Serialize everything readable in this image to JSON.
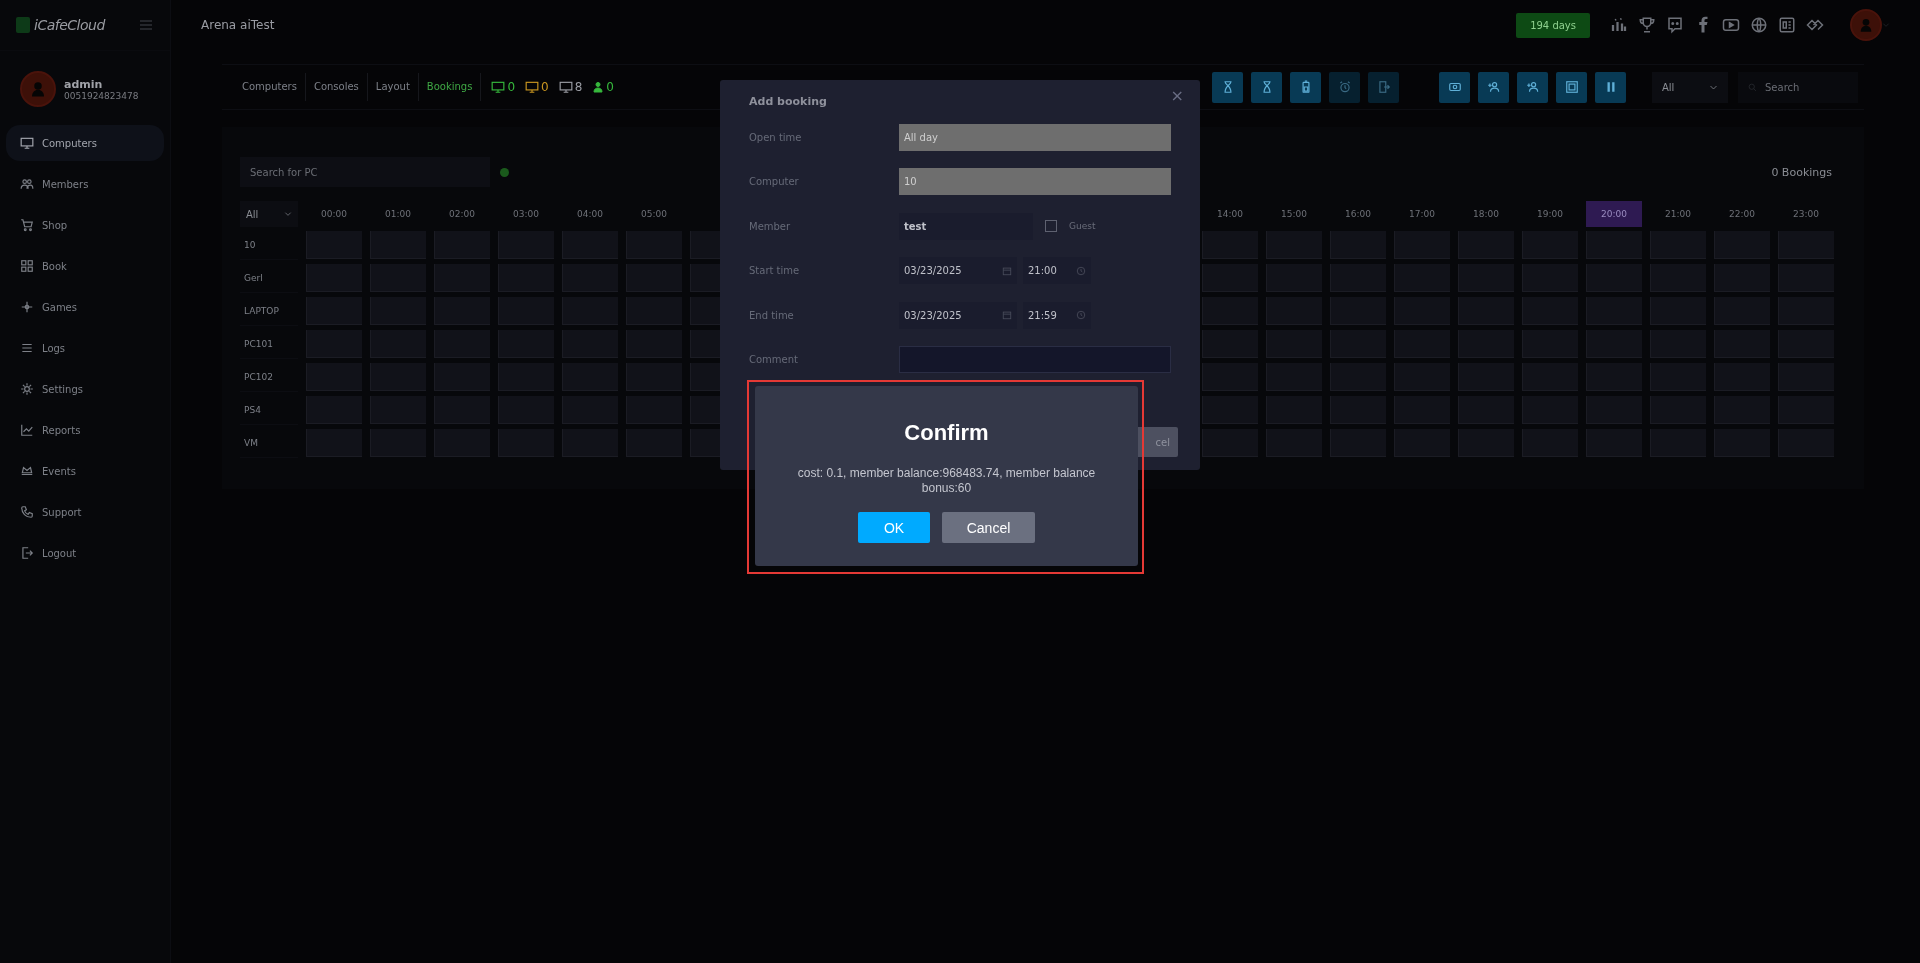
{
  "app": {
    "logo": "iCafeCloud",
    "title": "Arena aiTest"
  },
  "user": {
    "name": "admin",
    "phone": "0051924823478"
  },
  "nav": [
    {
      "label": "Computers",
      "selected": true
    },
    {
      "label": "Members",
      "selected": false
    },
    {
      "label": "Shop",
      "selected": false
    },
    {
      "label": "Book",
      "selected": false
    },
    {
      "label": "Games",
      "selected": false
    },
    {
      "label": "Logs",
      "selected": false
    },
    {
      "label": "Settings",
      "selected": false
    },
    {
      "label": "Reports",
      "selected": false
    },
    {
      "label": "Events",
      "selected": false
    },
    {
      "label": "Support",
      "selected": false
    },
    {
      "label": "Logout",
      "selected": false
    }
  ],
  "license": {
    "days": "194 days"
  },
  "tabs": [
    {
      "label": "Computers",
      "selected": false
    },
    {
      "label": "Consoles",
      "selected": false
    },
    {
      "label": "Layout",
      "selected": false
    },
    {
      "label": "Bookings",
      "selected": true
    }
  ],
  "status_counts": [
    {
      "kind": "monitor",
      "count": "0",
      "color": "#36b83c"
    },
    {
      "kind": "monitor",
      "count": "0",
      "color": "#c89520"
    },
    {
      "kind": "monitor",
      "count": "8",
      "color": "#9a9ca3"
    },
    {
      "kind": "person",
      "count": "0",
      "color": "#36b83c"
    }
  ],
  "toolbar": [
    {
      "kind": "hourglass",
      "disabled": false
    },
    {
      "kind": "hourglass",
      "disabled": false
    },
    {
      "kind": "battery",
      "disabled": false
    },
    {
      "kind": "alarm",
      "disabled": true
    },
    {
      "kind": "exit",
      "disabled": true
    },
    {
      "kind": "eye",
      "disabled": false
    },
    {
      "kind": "user-add",
      "disabled": false
    },
    {
      "kind": "user-add",
      "disabled": false
    },
    {
      "kind": "image",
      "disabled": false
    },
    {
      "kind": "pause",
      "disabled": false
    }
  ],
  "filter": {
    "value": "All"
  },
  "search": {
    "placeholder": "Search"
  },
  "bookings": {
    "search_placeholder": "Search for PC",
    "count": "0 Bookings",
    "group": "All",
    "hours_left": [
      {
        "label": "00:00",
        "current": false
      },
      {
        "label": "01:00",
        "current": false
      },
      {
        "label": "02:00",
        "current": false
      },
      {
        "label": "03:00",
        "current": false
      },
      {
        "label": "04:00",
        "current": false
      },
      {
        "label": "05:00",
        "current": false
      }
    ],
    "hours_right": [
      {
        "label": "14:00",
        "current": false
      },
      {
        "label": "15:00",
        "current": false
      },
      {
        "label": "16:00",
        "current": false
      },
      {
        "label": "17:00",
        "current": false
      },
      {
        "label": "18:00",
        "current": false
      },
      {
        "label": "19:00",
        "current": false
      },
      {
        "label": "20:00",
        "current": true
      },
      {
        "label": "21:00",
        "current": false
      },
      {
        "label": "22:00",
        "current": false
      },
      {
        "label": "23:00",
        "current": false
      }
    ],
    "rows": [
      "10",
      "Gerl",
      "LAPTOP",
      "PC101",
      "PC102",
      "PS4",
      "VM"
    ]
  },
  "add_booking": {
    "title": "Add booking",
    "close": "×",
    "fields": [
      {
        "kind": "text",
        "label": "Open time",
        "value": "All day",
        "disabled": true
      },
      {
        "kind": "text",
        "label": "Computer",
        "value": "10",
        "disabled": true
      },
      {
        "kind": "member",
        "label": "Member",
        "value": "test",
        "guest_label": "Guest",
        "guest_checked": false
      },
      {
        "kind": "datetime",
        "label": "Start time",
        "date": "03/23/2025",
        "time": "21:00"
      },
      {
        "kind": "datetime",
        "label": "End time",
        "date": "03/23/2025",
        "time": "21:59"
      },
      {
        "kind": "comment",
        "label": "Comment"
      }
    ],
    "cancel_visible": "cel"
  },
  "confirm": {
    "title": "Confirm",
    "message": "cost: 0.1, member balance:968483.74, member balance bonus:60",
    "ok": "OK",
    "cancel": "Cancel"
  }
}
